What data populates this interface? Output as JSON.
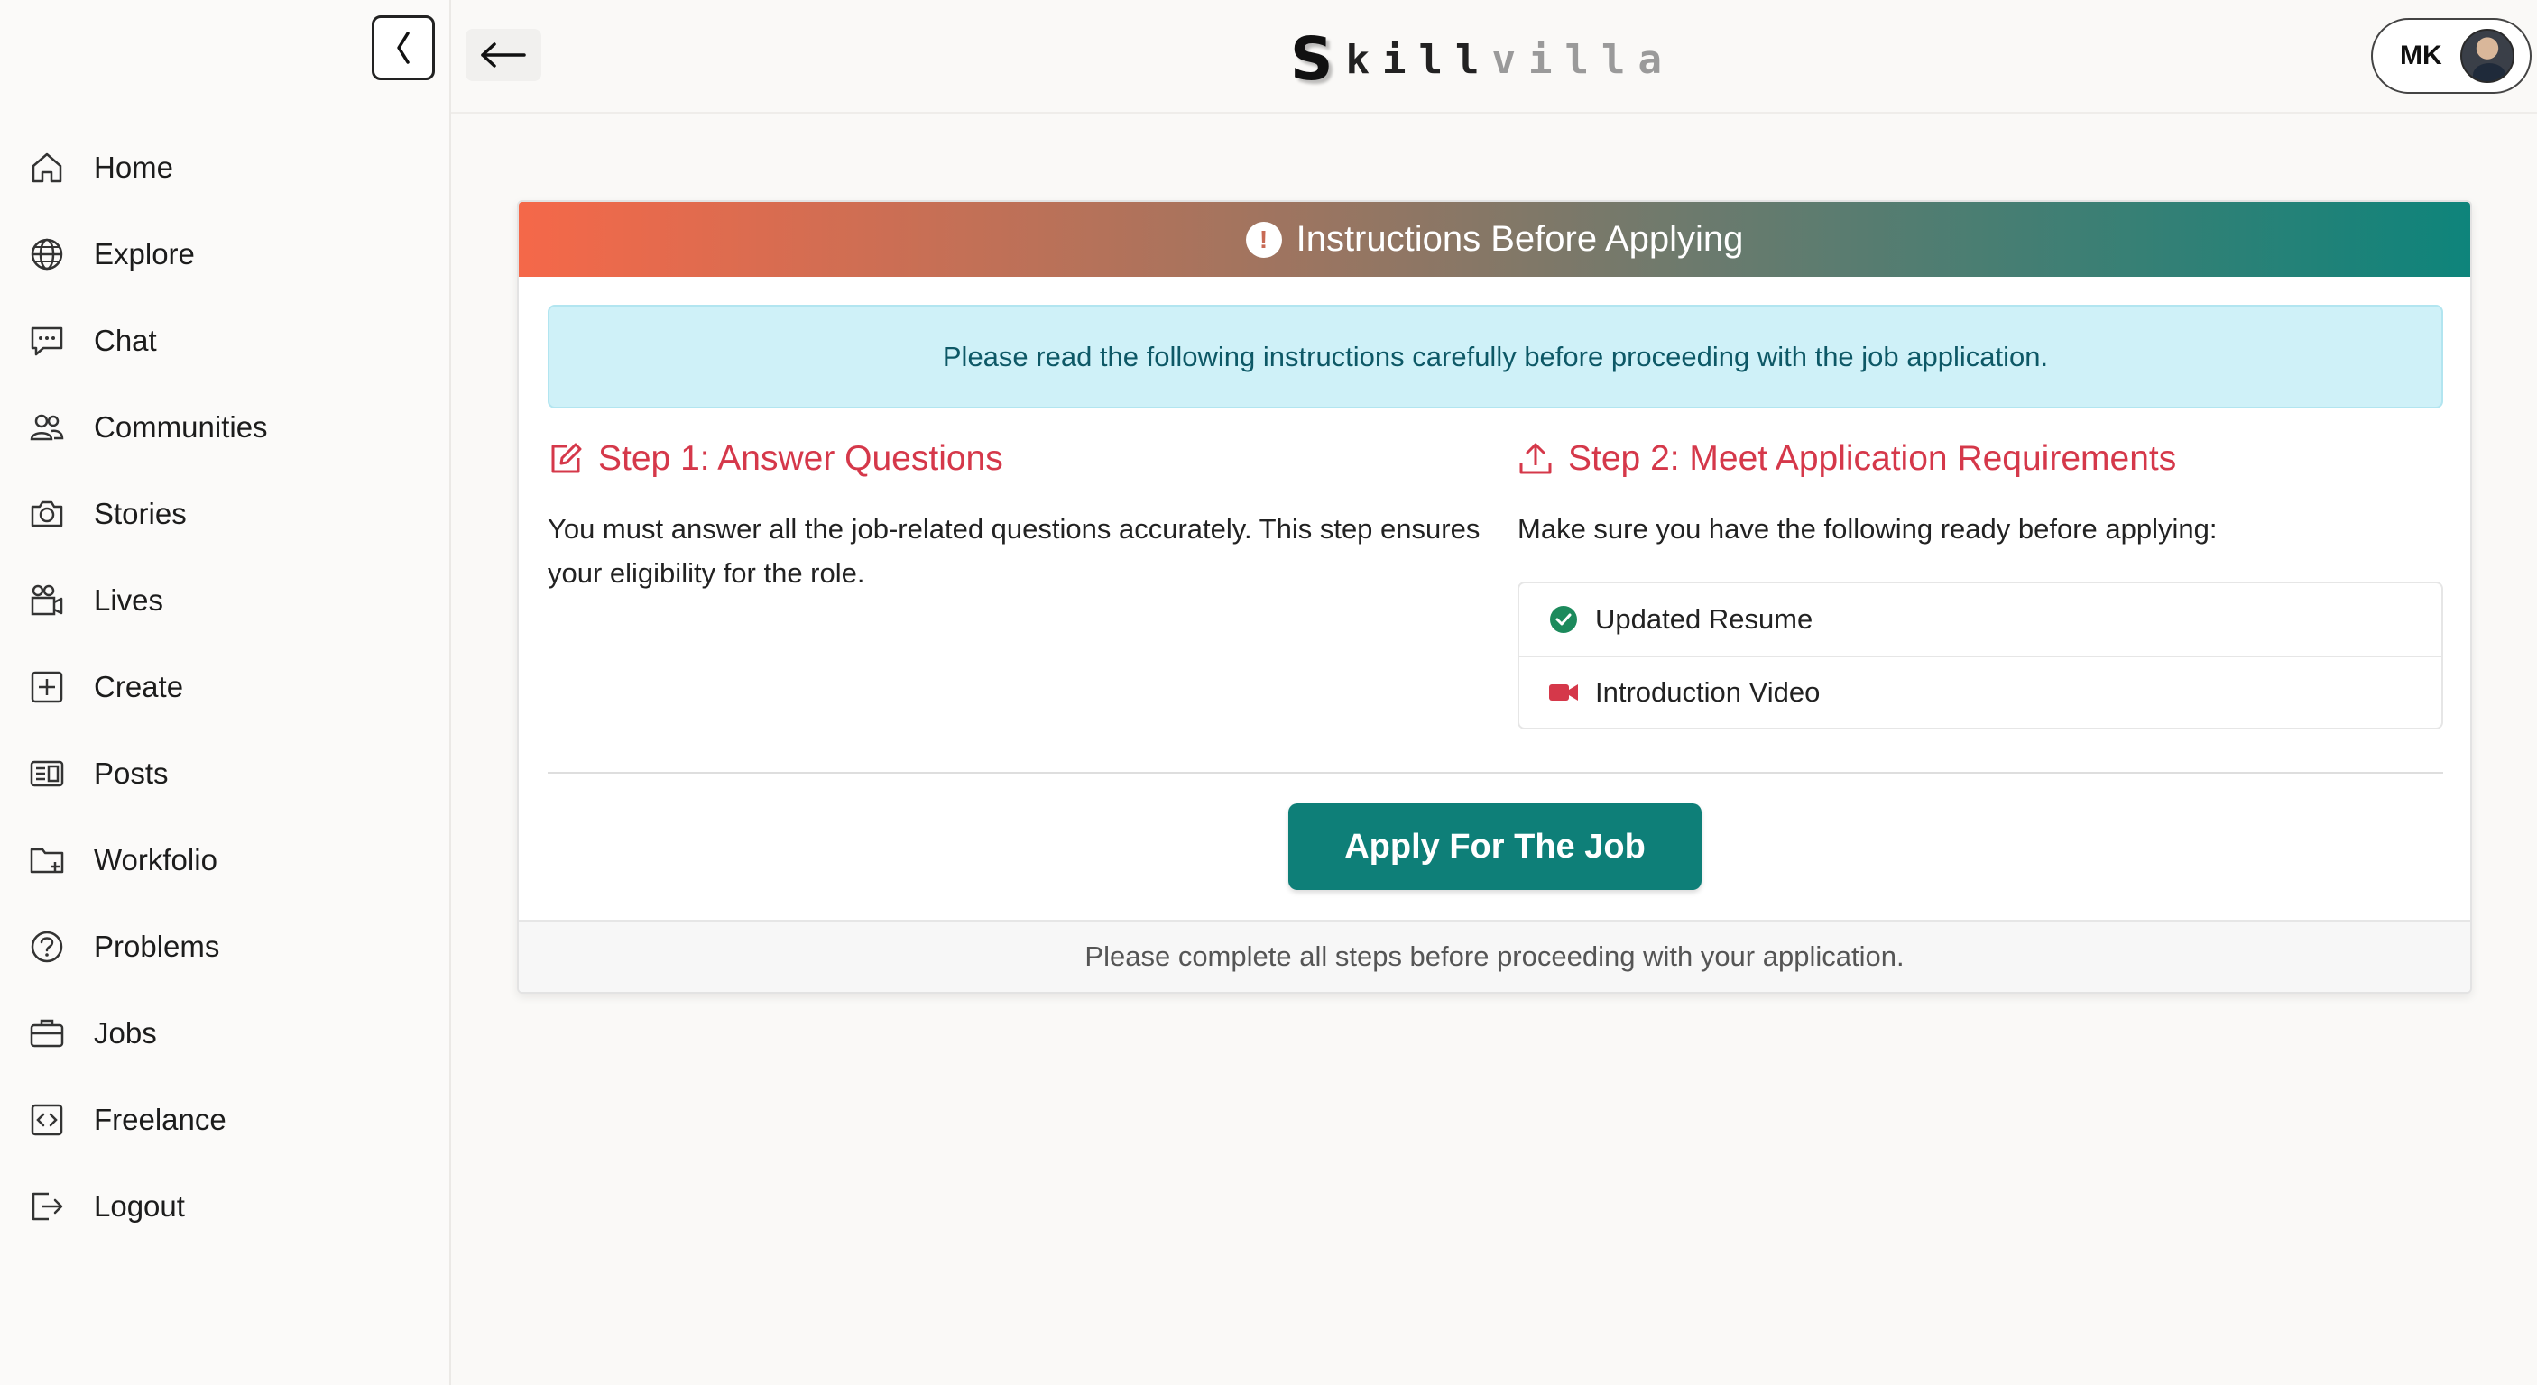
{
  "brand": {
    "logo_initial": "S",
    "logo_dark": "kill",
    "logo_light": "villa"
  },
  "sidebar": {
    "items": [
      {
        "label": "Home",
        "icon": "home-icon"
      },
      {
        "label": "Explore",
        "icon": "globe-icon"
      },
      {
        "label": "Chat",
        "icon": "chat-icon"
      },
      {
        "label": "Communities",
        "icon": "people-icon"
      },
      {
        "label": "Stories",
        "icon": "camera-icon"
      },
      {
        "label": "Lives",
        "icon": "video-people-icon"
      },
      {
        "label": "Create",
        "icon": "plus-square-icon"
      },
      {
        "label": "Posts",
        "icon": "newspaper-icon"
      },
      {
        "label": "Workfolio",
        "icon": "folder-plus-icon"
      },
      {
        "label": "Problems",
        "icon": "question-circle-icon"
      },
      {
        "label": "Jobs",
        "icon": "briefcase-icon"
      },
      {
        "label": "Freelance",
        "icon": "code-square-icon"
      },
      {
        "label": "Logout",
        "icon": "logout-icon"
      }
    ]
  },
  "header": {
    "profile_initials": "MK"
  },
  "card": {
    "title": "Instructions Before Applying",
    "info": "Please read the following instructions carefully before proceeding with the job application.",
    "step1": {
      "title": "Step 1: Answer Questions",
      "text": "You must answer all the job-related questions accurately. This step ensures your eligibility for the role."
    },
    "step2": {
      "title": "Step 2: Meet Application Requirements",
      "text": "Make sure you have the following ready before applying:",
      "requirements": [
        "Updated Resume",
        "Introduction Video"
      ]
    },
    "apply_label": "Apply For The Job",
    "footer": "Please complete all steps before proceeding with your application."
  },
  "colors": {
    "accent_teal": "#0e7f78",
    "step_red": "#d5384a",
    "header_gradient_start": "#f56849",
    "header_gradient_end": "#0e847b",
    "info_bg": "#cff1f8"
  }
}
